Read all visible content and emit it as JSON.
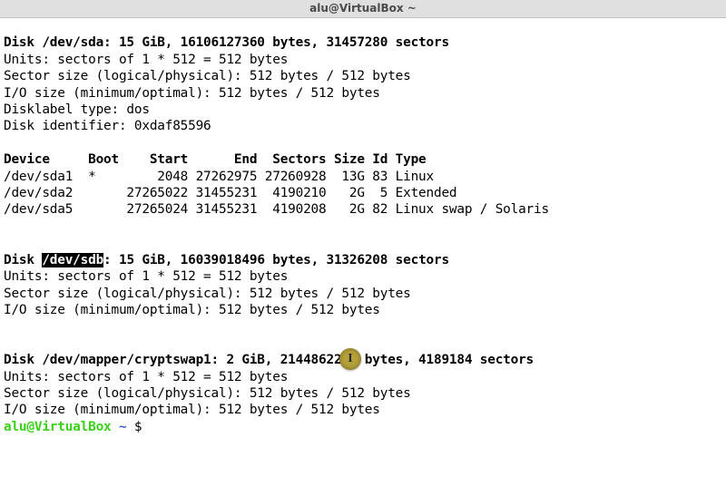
{
  "window": {
    "title": "alu@VirtualBox ~"
  },
  "disks": {
    "sda": {
      "header": "Disk /dev/sda: 15 GiB, 16106127360 bytes, 31457280 sectors",
      "units": "Units: sectors of 1 * 512 = 512 bytes",
      "sector": "Sector size (logical/physical): 512 bytes / 512 bytes",
      "io": "I/O size (minimum/optimal): 512 bytes / 512 bytes",
      "label": "Disklabel type: dos",
      "ident": "Disk identifier: 0xdaf85596"
    },
    "parts": {
      "head": "Device     Boot    Start      End  Sectors Size Id Type",
      "r0": "/dev/sda1  *        2048 27262975 27260928  13G 83 Linux",
      "r1": "/dev/sda2       27265022 31455231  4190210   2G  5 Extended",
      "r2": "/dev/sda5       27265024 31455231  4190208   2G 82 Linux swap / Solaris"
    },
    "sdb": {
      "head_pre": "Disk ",
      "head_hl": "/dev/sdb",
      "head_post": ": 15 GiB, 16039018496 bytes, 31326208 sectors",
      "units": "Units: sectors of 1 * 512 = 512 bytes",
      "sector": "Sector size (logical/physical): 512 bytes / 512 bytes",
      "io": "I/O size (minimum/optimal): 512 bytes / 512 bytes"
    },
    "cryptswap": {
      "header": "Disk /dev/mapper/cryptswap1: 2 GiB, 2144862208 bytes, 4189184 sectors",
      "units": "Units: sectors of 1 * 512 = 512 bytes",
      "sector": "Sector size (logical/physical): 512 bytes / 512 bytes",
      "io": "I/O size (minimum/optimal): 512 bytes / 512 bytes"
    }
  },
  "prompt": {
    "user": "alu@VirtualBox",
    "sep1": " ",
    "path": "~",
    "sep2": " $ "
  },
  "cursor_glyph": "I"
}
